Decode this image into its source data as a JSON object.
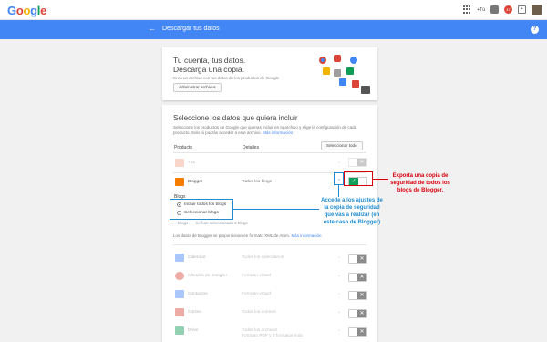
{
  "header": {
    "logo": "Google",
    "plus_count": "+Tú",
    "gp_badge": "47",
    "back": "←",
    "title": "Descargar tus datos",
    "help": "?"
  },
  "intro": {
    "title_line1": "Tu cuenta, tus datos.",
    "title_line2": "Descarga una copia.",
    "subtitle": "Crea un archivo con tus datos de los productos de Google",
    "button": "Administrar archivos"
  },
  "select": {
    "title": "Seleccione los datos que quiera incluir",
    "description": "Seleccione los productos de Google que quieras incluir en tu archivo y elige la configuración de cada producto. Solo tú podrás acceder a este archivo.",
    "more_info": "Más información",
    "col_product": "Producto",
    "col_details": "Detalles",
    "select_all": "Seleccionar todo"
  },
  "products": [
    {
      "name": "+1s",
      "details": "",
      "enabled": false,
      "color": "#f4a38a",
      "faded": true
    },
    {
      "name": "Blogger",
      "details": "Todos los blogs",
      "enabled": true,
      "color": "#f57d00",
      "faded": false
    }
  ],
  "blogs": {
    "label": "Blogs",
    "option_all": "Incluir todos los blogs",
    "option_select": "Seleccionar blogs",
    "meta_type": "Blogs",
    "meta_count": "Se han seleccionado 2 blogs",
    "format_text": "Los datos de Blogger se proporcionan en formato XML de Atom.",
    "format_link": "Más información"
  },
  "more_products": [
    {
      "name": "Calendar",
      "details": "Todos los calendarios",
      "details2": "",
      "color": "#4285f4"
    },
    {
      "name": "Círculos de Google+",
      "details": "Formato vCard",
      "details2": "",
      "color": "#db4437"
    },
    {
      "name": "Contactos",
      "details": "Formato vCard",
      "details2": "",
      "color": "#4285f4"
    },
    {
      "name": "Correo",
      "details": "Todos los correos",
      "details2": "",
      "color": "#db4437"
    },
    {
      "name": "Drive",
      "details": "Todos los archivos",
      "details2": "Formato PDF y 3 formatos más",
      "color": "#0f9d58"
    }
  ],
  "annotations": {
    "blue": "Accede a los ajustes de la copia de seguridad que vas a realizar (en este caso de Blogger)",
    "red": "Exporta una copia de seguridad de todos los blogs de Blogger."
  },
  "toggle_on_symbol": "✓",
  "toggle_off_symbol": "✕",
  "chevron": "⌄"
}
